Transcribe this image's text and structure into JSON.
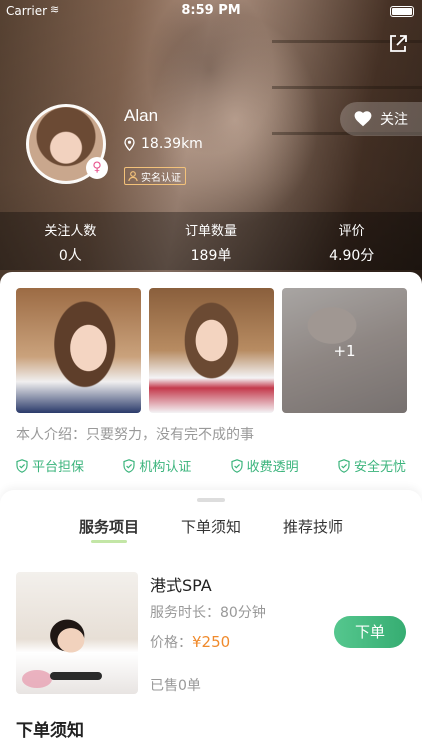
{
  "status_bar": {
    "carrier": "Carrier",
    "time": "8:59 PM"
  },
  "profile": {
    "name": "Alan",
    "distance": "18.39km",
    "verify_label": "实名认证",
    "follow_label": "关注",
    "icons": {
      "share": "share-icon",
      "heart": "heart-icon",
      "location": "location-pin-icon",
      "gender": "female-icon"
    }
  },
  "stats": [
    {
      "label": "关注人数",
      "value": "0人"
    },
    {
      "label": "订单数量",
      "value": "189单"
    },
    {
      "label": "评价",
      "value": "4.90分"
    }
  ],
  "photos": {
    "more_count": "+1"
  },
  "intro": "本人介绍：只要努力，没有完不成的事",
  "guarantees": [
    "平台担保",
    "机构认证",
    "收费透明",
    "安全无忧"
  ],
  "tabs": [
    "服务项目",
    "下单须知",
    "推荐技师"
  ],
  "active_tab": "服务项目",
  "service": {
    "name": "港式SPA",
    "duration": "服务时长：80分钟",
    "price_label": "价格：",
    "price": "¥250",
    "sold": "已售0单",
    "order_label": "下单"
  },
  "notice_title": "下单须知",
  "colors": {
    "accent_green": "#3bb47c",
    "price_orange": "#f08a2c",
    "tab_underline": "#c3e6a6"
  }
}
